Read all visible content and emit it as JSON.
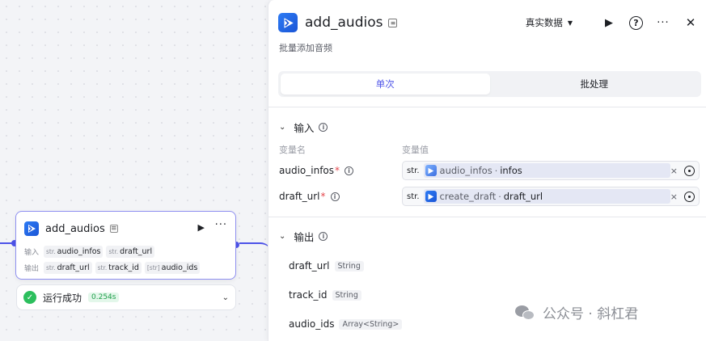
{
  "node": {
    "title": "add_audios",
    "in_label": "输入",
    "out_label": "输出",
    "inputs": [
      {
        "type": "str.",
        "name": "audio_infos"
      },
      {
        "type": "str.",
        "name": "draft_url"
      }
    ],
    "outputs": [
      {
        "type": "str.",
        "name": "draft_url"
      },
      {
        "type": "str.",
        "name": "track_id"
      },
      {
        "type": "[str]",
        "name": "audio_ids"
      }
    ],
    "status_text": "运行成功",
    "status_time": "0.254s"
  },
  "panel": {
    "title": "add_audios",
    "description": "批量添加音频",
    "data_source": "真实数据",
    "tabs": [
      "单次",
      "批处理"
    ],
    "active_tab": 0,
    "input_section": "输入",
    "col_name": "变量名",
    "col_value": "变量值",
    "inputs": [
      {
        "name": "audio_infos",
        "required": true,
        "type": "str.",
        "ref_node": "audio_infos",
        "sep": "·",
        "ref_var": "infos"
      },
      {
        "name": "draft_url",
        "required": true,
        "type": "str.",
        "ref_node": "create_draft",
        "sep": "·",
        "ref_var": "draft_url"
      }
    ],
    "output_section": "输出",
    "outputs": [
      {
        "name": "draft_url",
        "type": "String"
      },
      {
        "name": "track_id",
        "type": "String"
      },
      {
        "name": "audio_ids",
        "type": "Array<String>"
      }
    ]
  },
  "watermark": {
    "text": "公众号 · 斜杠君"
  },
  "colors": {
    "accent": "#4d53e8",
    "success": "#2cbf5d",
    "required": "#e5484d"
  },
  "icons": [
    "play-icon",
    "help-icon",
    "more-icon",
    "close-icon",
    "info-icon",
    "chevron-down-icon",
    "clear-icon",
    "target-icon",
    "check-icon",
    "app-logo-icon"
  ]
}
